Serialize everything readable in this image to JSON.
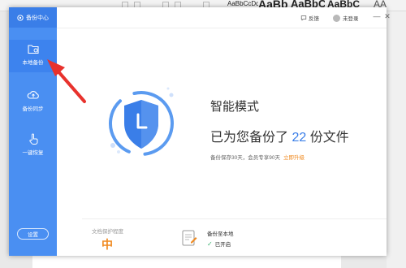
{
  "background": {
    "style_samples": [
      "AaBbCcDd",
      "AaBb",
      "AaBbC",
      "AaBbC",
      "AA"
    ]
  },
  "sidebar": {
    "header_label": "备份中心",
    "items": [
      {
        "label": "本地备份",
        "icon": "folder-icon",
        "active": true
      },
      {
        "label": "备份同步",
        "icon": "cloud-upload-icon",
        "active": false
      },
      {
        "label": "一键恢复",
        "icon": "hand-pointer-icon",
        "active": false
      }
    ],
    "settings_label": "设置"
  },
  "topbar": {
    "feedback_label": "反馈",
    "login_label": "未登录",
    "minimize_glyph": "—",
    "close_glyph": "✕"
  },
  "main": {
    "mode_title": "智能模式",
    "backup_prefix": "已为您备份了",
    "backup_count": "22",
    "backup_suffix": "份文件",
    "retention_text": "备份保存30天，会员专享90天",
    "upgrade_label": "立即升级"
  },
  "footer": {
    "protection_level_label": "文档保护程度",
    "protection_level_value": "中",
    "backup_location_label": "备份至本地",
    "backup_status": "已开启"
  },
  "colors": {
    "sidebar": "#4a8ff2",
    "accent": "#3a7ee8",
    "upgrade": "#f08a20",
    "annotation_arrow": "#e8322d"
  }
}
